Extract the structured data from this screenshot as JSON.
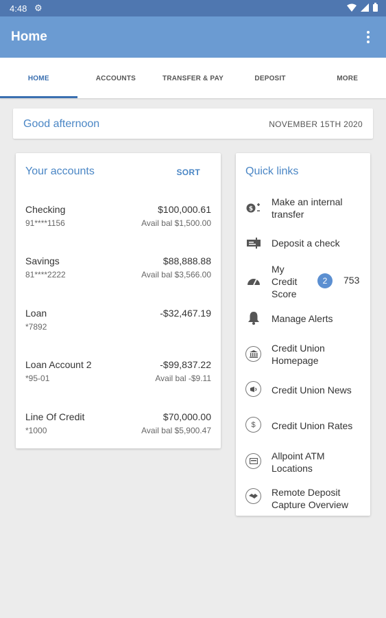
{
  "status_bar": {
    "time": "4:48",
    "icons": [
      "gear-icon",
      "wifi-icon",
      "signal-icon",
      "battery-icon"
    ]
  },
  "app_bar": {
    "title": "Home",
    "menu_icon": "more-vert-icon"
  },
  "tabs": [
    {
      "label": "HOME",
      "active": true
    },
    {
      "label": "ACCOUNTS",
      "active": false
    },
    {
      "label": "TRANSFER & PAY",
      "active": false
    },
    {
      "label": "DEPOSIT",
      "active": false
    },
    {
      "label": "MORE",
      "active": false
    }
  ],
  "greeting": {
    "text": "Good afternoon",
    "date": "NOVEMBER 15TH 2020"
  },
  "accounts_card": {
    "title": "Your accounts",
    "sort_label": "SORT",
    "items": [
      {
        "name": "Checking",
        "number": "91****1156",
        "amount": "$100,000.61",
        "avail": "Avail bal $1,500.00"
      },
      {
        "name": "Savings",
        "number": "81****2222",
        "amount": "$88,888.88",
        "avail": "Avail bal $3,566.00"
      },
      {
        "name": "Loan",
        "number": "*7892",
        "amount": "-$32,467.19",
        "avail": ""
      },
      {
        "name": "Loan Account 2",
        "number": "*95-01",
        "amount": "-$99,837.22",
        "avail": "Avail bal -$9.11"
      },
      {
        "name": "Line Of Credit",
        "number": "*1000",
        "amount": "$70,000.00",
        "avail": "Avail bal $5,900.47"
      }
    ]
  },
  "quick_links": {
    "title": "Quick links",
    "items": [
      {
        "label_lines": [
          "Make an internal",
          "transfer"
        ],
        "icon": "transfer-icon"
      },
      {
        "label_lines": [
          "Deposit a check"
        ],
        "icon": "check-deposit-icon"
      },
      {
        "label_lines": [
          "My",
          "Credit",
          "Score"
        ],
        "icon": "gauge-icon",
        "badge": "2",
        "score": "753"
      },
      {
        "label_lines": [
          "Manage Alerts"
        ],
        "icon": "bell-icon"
      },
      {
        "label_lines": [
          "Credit Union",
          "Homepage"
        ],
        "icon": "bank-icon"
      },
      {
        "label_lines": [
          "Credit Union News"
        ],
        "icon": "news-icon"
      },
      {
        "label_lines": [
          "Credit Union Rates"
        ],
        "icon": "dollar-icon"
      },
      {
        "label_lines": [
          "Allpoint ATM",
          "Locations"
        ],
        "icon": "atm-icon"
      },
      {
        "label_lines": [
          "Remote Deposit",
          "Capture Overview"
        ],
        "icon": "handshake-icon"
      }
    ]
  }
}
